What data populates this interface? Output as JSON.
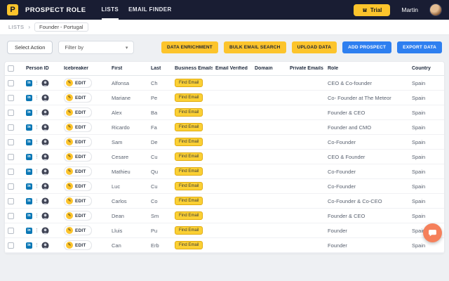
{
  "topbar": {
    "brand": "PROSPECT ROLE",
    "logo_letter": "P",
    "nav": [
      {
        "label": "LISTS"
      },
      {
        "label": "EMAIL FINDER"
      }
    ],
    "trial_label": "Trial",
    "user_name": "Martin"
  },
  "breadcrumb": {
    "root": "LISTS",
    "separator": "›",
    "current": "Founder - Portugal"
  },
  "toolbar": {
    "select_action_label": "Select Action",
    "filter_placeholder": "Filter by",
    "buttons": [
      {
        "label": "DATA ENRICHMENT",
        "style": "yellow"
      },
      {
        "label": "BULK EMAIL SEARCH",
        "style": "yellow"
      },
      {
        "label": "UPLOAD DATA",
        "style": "yellow"
      },
      {
        "label": "ADD PROSPECT",
        "style": "blue"
      },
      {
        "label": "EXPORT DATA",
        "style": "blue"
      }
    ]
  },
  "colors": {
    "accent_yellow": "#fcc42c",
    "accent_blue": "#2e7ff0",
    "topbar_bg": "#191d33",
    "linkedin_blue": "#0a77b5",
    "chat_fab": "#f5805b"
  },
  "table": {
    "headers": [
      "Person ID",
      "Icebreaker",
      "First",
      "Last",
      "Business Emails",
      "Email Verified",
      "Domain",
      "Private Emails",
      "Role",
      "Country"
    ],
    "edit_label": "EDIT",
    "find_email_label": "Find Email",
    "rows": [
      {
        "first": "Alfonsa",
        "last": "Ch",
        "role": "CEO & Co-founder",
        "country": "Spain"
      },
      {
        "first": "Mariane",
        "last": "Pe",
        "role": "Co- Founder at The Meteor",
        "country": "Spain"
      },
      {
        "first": "Alex",
        "last": "Ba",
        "role": "Founder & CEO",
        "country": "Spain"
      },
      {
        "first": "Ricardo",
        "last": "Fa",
        "role": "Founder and CMO",
        "country": "Spain"
      },
      {
        "first": "Sam",
        "last": "De",
        "role": "Co-Founder",
        "country": "Spain"
      },
      {
        "first": "Cesare",
        "last": "Cu",
        "role": "CEO & Founder",
        "country": "Spain"
      },
      {
        "first": "Mathieu",
        "last": "Qu",
        "role": "Co-Founder",
        "country": "Spain"
      },
      {
        "first": "Luc",
        "last": "Cu",
        "role": "Co-Founder",
        "country": "Spain"
      },
      {
        "first": "Carlos",
        "last": "Co",
        "role": "Co-Founder & Co-CEO",
        "country": "Spain"
      },
      {
        "first": "Dean",
        "last": "Sm",
        "role": "Founder & CEO",
        "country": "Spain"
      },
      {
        "first": "Lluis",
        "last": "Pu",
        "role": "Founder",
        "country": "Spain"
      },
      {
        "first": "Can",
        "last": "Erb",
        "role": "Founder",
        "country": "Spain"
      }
    ]
  }
}
